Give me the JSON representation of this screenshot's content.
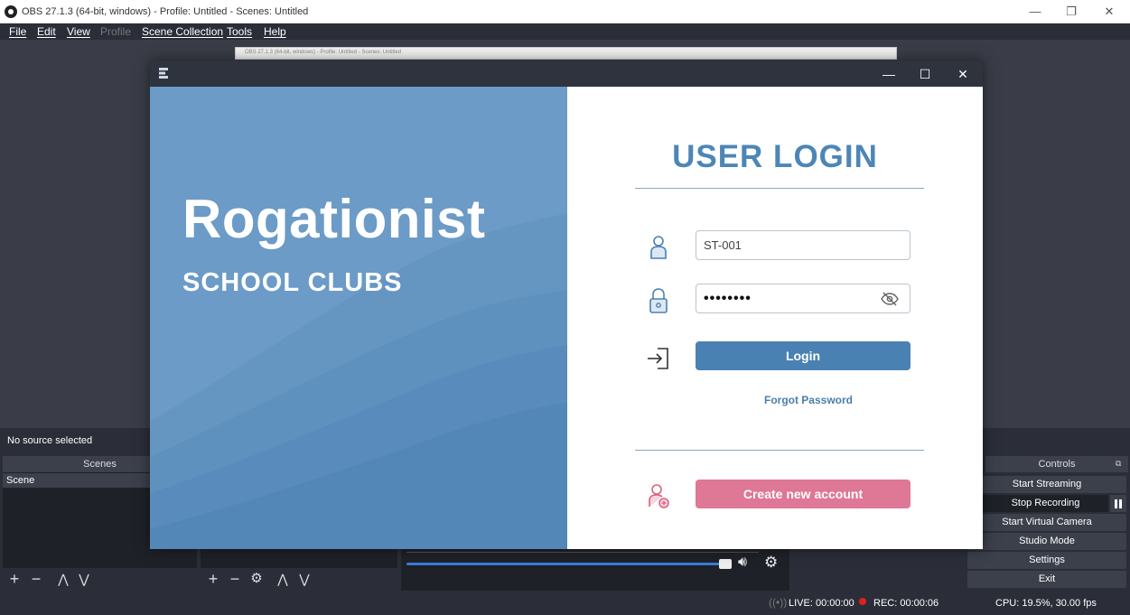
{
  "obs": {
    "title": "OBS 27.1.3 (64-bit, windows) - Profile: Untitled - Scenes: Untitled",
    "window_buttons": {
      "minimize": "—",
      "restore": "❐",
      "close": "✕"
    },
    "menu": [
      "File",
      "Edit",
      "View",
      "Profile",
      "Scene Collection",
      "Tools",
      "Help"
    ],
    "inner_window_title": "OBS 27.1.3 (64-bit, windows) - Profile: Untitled - Scenes: Untitled",
    "source_status": "No source selected",
    "scenes_header": "Scenes",
    "scene_item": "Scene",
    "controls_header": "Controls",
    "controls": [
      "Start Streaming",
      "Stop Recording",
      "Start Virtual Camera",
      "Studio Mode",
      "Settings",
      "Exit"
    ],
    "status": {
      "live": "LIVE: 00:00:00",
      "rec": "REC: 00:00:06",
      "cpu": "CPU: 19.5%, 30.00 fps"
    }
  },
  "login_app": {
    "window_buttons": {
      "minimize": "—",
      "maximize": "☐",
      "close": "✕"
    },
    "brand_title": "Rogationist",
    "brand_subtitle": "SCHOOL CLUBS",
    "heading": "USER LOGIN",
    "username_value": "ST-001",
    "password_dots": "••••••••",
    "login_label": "Login",
    "forgot_label": "Forgot Password",
    "create_label": "Create new account",
    "colors": {
      "hero_blue": "#6b9bc6",
      "accent_blue": "#4a81b3",
      "accent_pink": "#df7797"
    }
  }
}
